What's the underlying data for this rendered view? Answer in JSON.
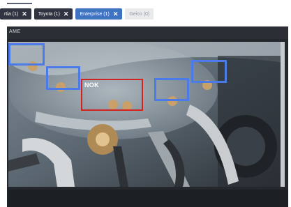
{
  "filters": {
    "chips": [
      {
        "label": "rtia (1)",
        "state": "dark"
      },
      {
        "label": "Toyota (1)",
        "state": "dark"
      },
      {
        "label": "Enterprise (1)",
        "state": "active"
      },
      {
        "label": "Geico (0)",
        "state": "inactive"
      }
    ],
    "close_icon": "close-icon"
  },
  "viewer": {
    "header_text": "AME",
    "annotations": [
      {
        "id": "bolt-1",
        "class": "ok",
        "color": "#4a7be6"
      },
      {
        "id": "bolt-2",
        "class": "ok",
        "color": "#4a7be6"
      },
      {
        "id": "bolt-3",
        "class": "NOK",
        "color": "#d32222",
        "label": "NOK"
      },
      {
        "id": "bolt-4",
        "class": "ok",
        "color": "#4a7be6"
      },
      {
        "id": "bolt-5",
        "class": "ok",
        "color": "#4a7be6"
      }
    ]
  }
}
